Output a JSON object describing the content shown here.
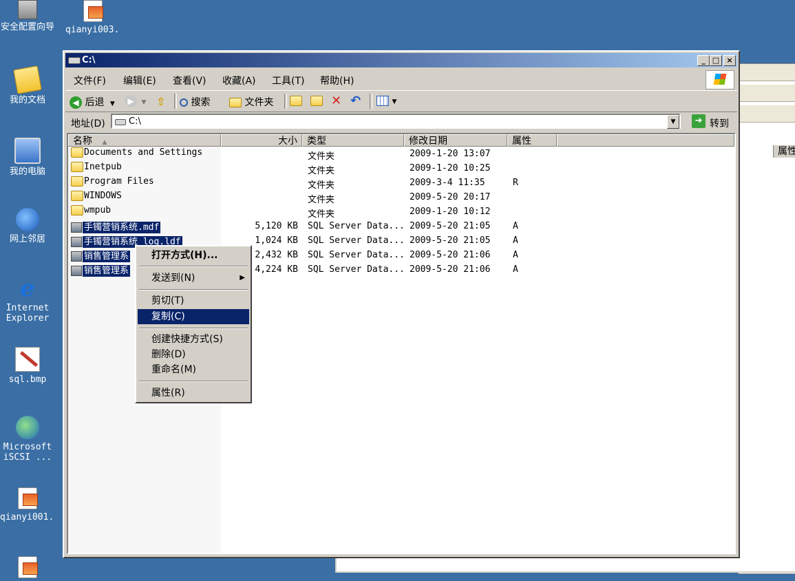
{
  "desktop": {
    "icons": [
      {
        "label": "安全配置向导",
        "icon": "security-wizard-icon"
      },
      {
        "label": "qianyi003...",
        "icon": "document-icon"
      },
      {
        "label": "我的文档",
        "icon": "my-documents-icon"
      },
      {
        "label": "我的电脑",
        "icon": "my-computer-icon"
      },
      {
        "label": "网上邻居",
        "icon": "network-places-icon"
      },
      {
        "label": "Internet Explorer",
        "icon": "internet-explorer-icon"
      },
      {
        "label": "sql.bmp",
        "icon": "bitmap-icon"
      },
      {
        "label": "Microsoft iSCSI ...",
        "icon": "iscsi-icon"
      },
      {
        "label": "qianyi001...",
        "icon": "document-icon"
      }
    ]
  },
  "window": {
    "title": "C:\\",
    "minimize": "_",
    "maximize": "□",
    "close": "×"
  },
  "menubar": {
    "items": [
      "文件(F)",
      "编辑(E)",
      "查看(V)",
      "收藏(A)",
      "工具(T)",
      "帮助(H)"
    ]
  },
  "toolbar": {
    "back": "后退",
    "search": "搜索",
    "folders": "文件夹"
  },
  "address": {
    "label": "地址(D)",
    "value": "C:\\",
    "go": "转到"
  },
  "columns": {
    "name": "名称",
    "size": "大小",
    "type": "类型",
    "modified": "修改日期",
    "attributes": "属性"
  },
  "files": [
    {
      "name": "Documents and Settings",
      "size": "",
      "type": "文件夹",
      "modified": "2009-1-20 13:07",
      "attr": "",
      "kind": "folder",
      "selected": false
    },
    {
      "name": "Inetpub",
      "size": "",
      "type": "文件夹",
      "modified": "2009-1-20 10:25",
      "attr": "",
      "kind": "folder",
      "selected": false
    },
    {
      "name": "Program Files",
      "size": "",
      "type": "文件夹",
      "modified": "2009-3-4 11:35",
      "attr": "R",
      "kind": "folder",
      "selected": false
    },
    {
      "name": "WINDOWS",
      "size": "",
      "type": "文件夹",
      "modified": "2009-5-20 20:17",
      "attr": "",
      "kind": "folder",
      "selected": false
    },
    {
      "name": "wmpub",
      "size": "",
      "type": "文件夹",
      "modified": "2009-1-20 10:12",
      "attr": "",
      "kind": "folder",
      "selected": false
    },
    {
      "name": "手镯营销系统.mdf",
      "size": "5,120 KB",
      "type": "SQL Server Data...",
      "modified": "2009-5-20 21:05",
      "attr": "A",
      "kind": "db",
      "selected": true
    },
    {
      "name": "手镯营销系统_log.ldf",
      "size": "1,024 KB",
      "type": "SQL Server Data...",
      "modified": "2009-5-20 21:05",
      "attr": "A",
      "kind": "db",
      "selected": true
    },
    {
      "name": "销售管理系",
      "size": "2,432 KB",
      "type": "SQL Server Data...",
      "modified": "2009-5-20 21:06",
      "attr": "A",
      "kind": "db",
      "selected": true
    },
    {
      "name": "销售管理系",
      "size": "4,224 KB",
      "type": "SQL Server Data...",
      "modified": "2009-5-20 21:06",
      "attr": "A",
      "kind": "db",
      "selected": true
    }
  ],
  "context_menu": {
    "open_with": "打开方式(H)...",
    "send_to": "发送到(N)",
    "cut": "剪切(T)",
    "copy": "复制(C)",
    "create_shortcut": "创建快捷方式(S)",
    "delete": "删除(D)",
    "rename": "重命名(M)",
    "properties": "属性(R)"
  },
  "background_window": {
    "column": "属性"
  }
}
